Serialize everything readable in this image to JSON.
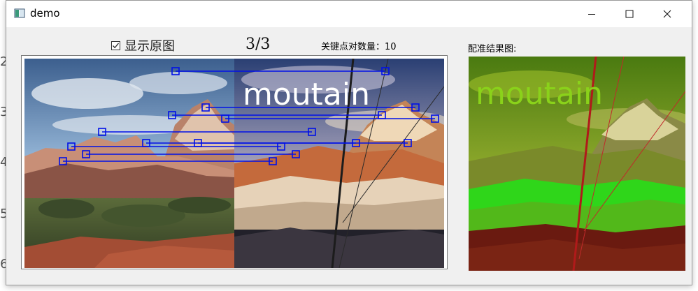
{
  "window": {
    "title": "demo",
    "buttons": {
      "minimize": "minimize",
      "maximize": "maximize",
      "close": "close"
    }
  },
  "controls": {
    "show_original_label": "显示原图",
    "show_original_checked": true,
    "page_counter": "3/3",
    "keypoint_pairs_label": "关键点对数量：10",
    "result_label": "配准结果图:"
  },
  "images": {
    "left_watermark": "moutain",
    "result_watermark": "moutain"
  },
  "colors": {
    "match_line": "#0010e8",
    "result_tint": "#8ad21a"
  },
  "icons": {
    "app": "app-window-icon",
    "checkbox": "checkmark-icon"
  }
}
